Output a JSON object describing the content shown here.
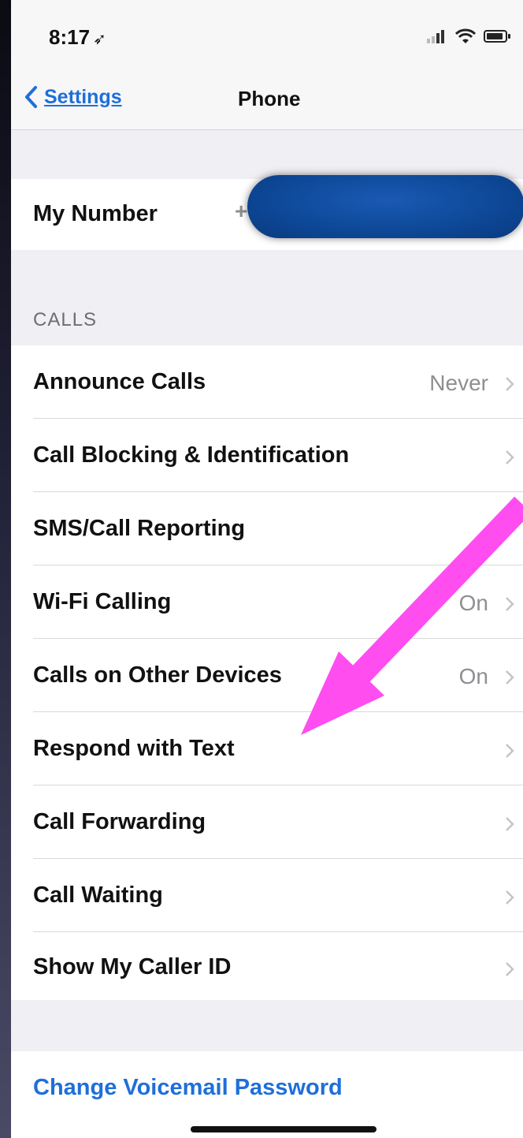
{
  "status": {
    "time": "8:17",
    "location_glyph": "➶"
  },
  "nav": {
    "back_label": "Settings",
    "title": "Phone"
  },
  "my_number": {
    "label": "My Number",
    "value_peek": "+"
  },
  "calls_section": {
    "header": "CALLS",
    "rows": [
      {
        "label": "Announce Calls",
        "value": "Never"
      },
      {
        "label": "Call Blocking & Identification",
        "value": ""
      },
      {
        "label": "SMS/Call Reporting",
        "value": ""
      },
      {
        "label": "Wi-Fi Calling",
        "value": "On"
      },
      {
        "label": "Calls on Other Devices",
        "value": "On"
      },
      {
        "label": "Respond with Text",
        "value": ""
      },
      {
        "label": "Call Forwarding",
        "value": ""
      },
      {
        "label": "Call Waiting",
        "value": ""
      },
      {
        "label": "Show My Caller ID",
        "value": ""
      }
    ]
  },
  "voicemail": {
    "label": "Change Voicemail Password"
  },
  "colors": {
    "accent": "#1e6fd9",
    "annotation_arrow": "#ff4df0",
    "redaction": "#0d4796"
  },
  "icons": [
    "signal-icon",
    "wifi-icon",
    "battery-icon",
    "back-chevron-icon",
    "chevron-right-icon"
  ]
}
